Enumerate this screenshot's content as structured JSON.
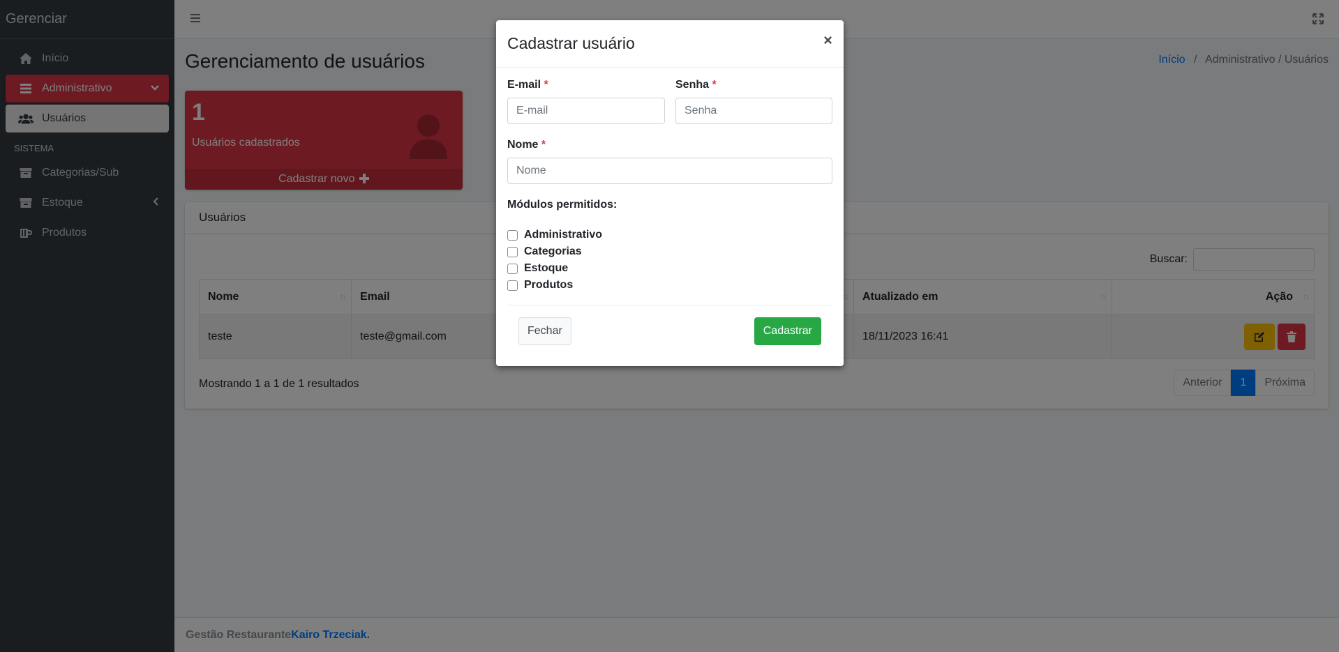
{
  "sidebar": {
    "brand": "Gerenciar",
    "items": [
      {
        "label": "Início",
        "icon": "home-icon"
      },
      {
        "label": "Administrativo",
        "icon": "bars-icon"
      },
      {
        "label": "Usuários",
        "icon": "users-icon"
      }
    ],
    "section_header": "SISTEMA",
    "system_items": [
      {
        "label": "Categorias/Sub",
        "icon": "archive-icon"
      },
      {
        "label": "Estoque",
        "icon": "box-icon"
      },
      {
        "label": "Produtos",
        "icon": "mug-icon"
      }
    ]
  },
  "page": {
    "title": "Gerenciamento de usuários",
    "breadcrumb_home": "Início",
    "breadcrumb_sep": "/",
    "breadcrumb_rest": "Administrativo / Usuários"
  },
  "stat_box": {
    "count": "1",
    "label": "Usuários cadastrados",
    "footer": "Cadastrar novo",
    "color": "#dc3545"
  },
  "card": {
    "title": "Usuários",
    "search_label": "Buscar:",
    "columns": [
      "Nome",
      "Email",
      "Atualizado em",
      "Ação"
    ],
    "rows": [
      {
        "nome": "teste",
        "email": "teste@gmail.com",
        "atualizado": "18/11/2023 16:41"
      }
    ],
    "info": "Mostrando 1 a 1 de 1 resultados",
    "pager": {
      "prev": "Anterior",
      "current": "1",
      "next": "Próxima"
    }
  },
  "footer": {
    "text": "Gestão Restaurante",
    "link": "Kairo Trzeciak."
  },
  "modal": {
    "title": "Cadastrar usuário",
    "close": "×",
    "email_label": "E-mail",
    "email_placeholder": "E-mail",
    "senha_label": "Senha",
    "senha_placeholder": "Senha",
    "nome_label": "Nome",
    "nome_placeholder": "Nome",
    "required_mark": "*",
    "modules_label": "Módulos permitidos:",
    "modules": [
      "Administrativo",
      "Categorias",
      "Estoque",
      "Produtos"
    ],
    "btn_close": "Fechar",
    "btn_submit": "Cadastrar"
  },
  "colors": {
    "accent_red": "#dc3545",
    "accent_green": "#28a745",
    "accent_yellow": "#ffc107",
    "link_blue": "#007bff",
    "sidebar_bg": "#343a40"
  }
}
